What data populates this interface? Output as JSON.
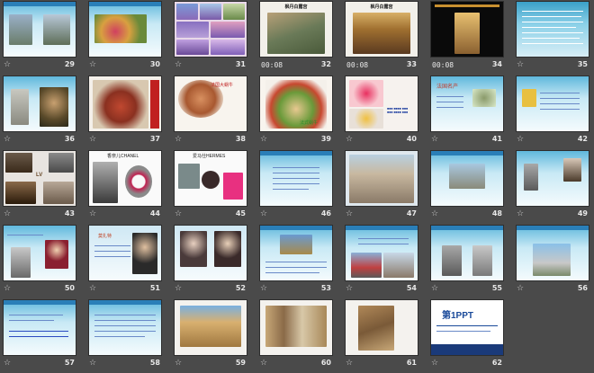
{
  "slides": [
    {
      "num": "29",
      "text": ""
    },
    {
      "num": "30",
      "text": ""
    },
    {
      "num": "31",
      "text": ""
    },
    {
      "num": "32",
      "text": "枫丹白露宫",
      "time": "00:08"
    },
    {
      "num": "33",
      "text": "枫丹白露宫",
      "time": "00:08"
    },
    {
      "num": "34",
      "text": "",
      "time": "00:08"
    },
    {
      "num": "35",
      "text": ""
    },
    {
      "num": "36",
      "text": ""
    },
    {
      "num": "37",
      "text": ""
    },
    {
      "num": "38",
      "text": "法国大蜗牛"
    },
    {
      "num": "39",
      "text": "法式蜗牛"
    },
    {
      "num": "40",
      "text": ""
    },
    {
      "num": "41",
      "text": "法国名产"
    },
    {
      "num": "42",
      "text": ""
    },
    {
      "num": "43",
      "text": "LV"
    },
    {
      "num": "44",
      "text": "香奈儿CHANEL"
    },
    {
      "num": "45",
      "text": "爱马仕HERMES"
    },
    {
      "num": "46",
      "text": ""
    },
    {
      "num": "47",
      "text": ""
    },
    {
      "num": "48",
      "text": ""
    },
    {
      "num": "49",
      "text": ""
    },
    {
      "num": "50",
      "text": ""
    },
    {
      "num": "51",
      "text": "莫扎特"
    },
    {
      "num": "52",
      "text": ""
    },
    {
      "num": "53",
      "text": ""
    },
    {
      "num": "54",
      "text": ""
    },
    {
      "num": "55",
      "text": ""
    },
    {
      "num": "56",
      "text": ""
    },
    {
      "num": "57",
      "text": ""
    },
    {
      "num": "58",
      "text": ""
    },
    {
      "num": "59",
      "text": ""
    },
    {
      "num": "60",
      "text": ""
    },
    {
      "num": "61",
      "text": ""
    },
    {
      "num": "62",
      "text": "第1PPT"
    }
  ],
  "star_glyph": "☆",
  "colors": {
    "background": "#4a4a4a",
    "accent": "#2a7fb8"
  }
}
